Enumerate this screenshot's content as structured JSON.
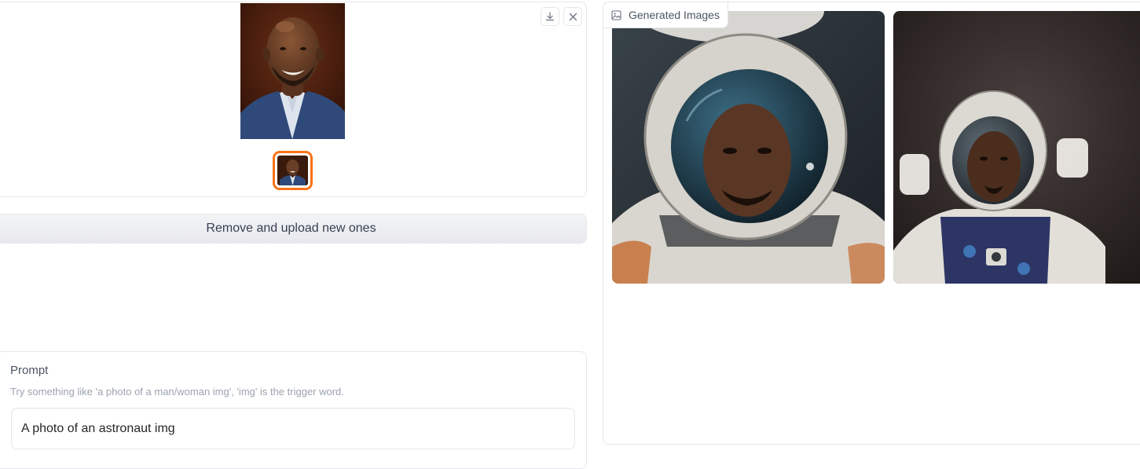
{
  "upload": {
    "download_icon": "download-icon",
    "close_icon": "close-icon",
    "preview_image": "uploaded-portrait-smiling-man",
    "thumbnail_image": "uploaded-portrait-thumbnail",
    "accent_color": "#f97316"
  },
  "remove_button": {
    "label": "Remove and upload new ones"
  },
  "prompt": {
    "label": "Prompt",
    "info": "Try something like 'a photo of a man/woman img', 'img' is the trigger word.",
    "value": "A photo of an astronaut img"
  },
  "gallery": {
    "label": "Generated Images",
    "label_icon": "image-icon",
    "images": [
      {
        "name": "generated-astronaut-closeup"
      },
      {
        "name": "generated-astronaut-portrait"
      }
    ]
  }
}
